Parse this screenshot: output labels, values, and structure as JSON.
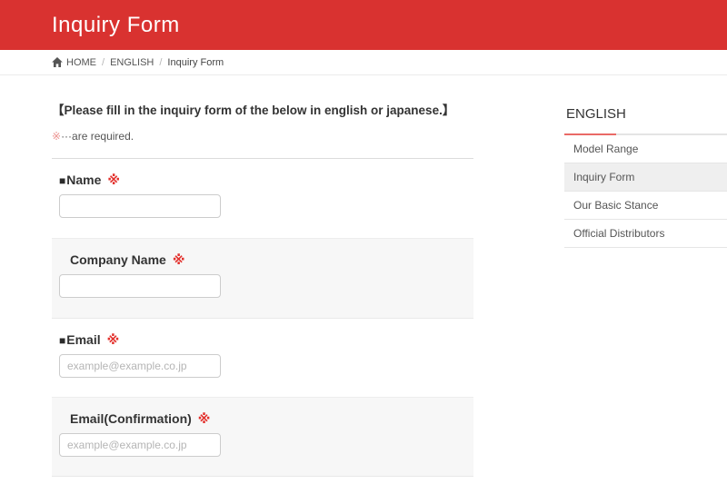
{
  "header": {
    "title": "Inquiry Form"
  },
  "breadcrumb": {
    "separator": "/",
    "items": [
      {
        "label": "HOME"
      },
      {
        "label": "ENGLISH"
      },
      {
        "label": "Inquiry Form"
      }
    ]
  },
  "content": {
    "intro_heading": "【Please fill in the inquiry form of the below in english or japanese.】",
    "required_note": {
      "mark": "※",
      "text": "···are required."
    },
    "form": {
      "fields": [
        {
          "label": "Name",
          "bullet": "■",
          "required_mark": "※",
          "placeholder": "",
          "value": ""
        },
        {
          "label": "Company Name",
          "bullet": "",
          "required_mark": "※",
          "placeholder": "",
          "value": ""
        },
        {
          "label": "Email",
          "bullet": "■",
          "required_mark": "※",
          "placeholder": "example@example.co.jp",
          "value": ""
        },
        {
          "label": "Email(Confirmation)",
          "bullet": "",
          "required_mark": "※",
          "placeholder": "example@example.co.jp",
          "value": ""
        }
      ]
    }
  },
  "sidebar": {
    "title": "ENGLISH",
    "items": [
      {
        "label": "Model Range",
        "active": false
      },
      {
        "label": "Inquiry Form",
        "active": true
      },
      {
        "label": "Our Basic Stance",
        "active": false
      },
      {
        "label": "Official Distributors",
        "active": false
      }
    ]
  },
  "colors": {
    "header_bg": "#d93230",
    "required_mark": "#e3312d",
    "note_mark": "#ec9390",
    "sidebar_accent": "#ea6a66",
    "row_shaded_bg": "#f7f7f7",
    "input_border": "#cccccc"
  }
}
